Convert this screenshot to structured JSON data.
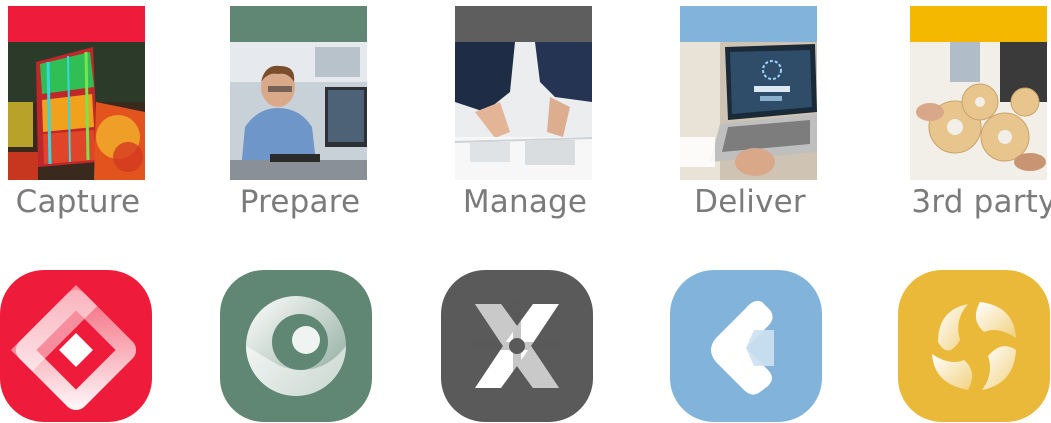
{
  "tiles": [
    {
      "label": "Capture",
      "bar_color": "#ee1c3a",
      "icon_color": "#ee1c3a",
      "icon": "capture-app-icon"
    },
    {
      "label": "Prepare",
      "bar_color": "#5f8774",
      "icon_color": "#5f8774",
      "icon": "prepare-app-icon"
    },
    {
      "label": "Manage",
      "bar_color": "#5e5e5e",
      "icon_color": "#5a5a5a",
      "icon": "manage-app-icon"
    },
    {
      "label": "Deliver",
      "bar_color": "#82b4db",
      "icon_color": "#82b4db",
      "icon": "deliver-app-icon"
    },
    {
      "label": "3rd party",
      "bar_color": "#f5b800",
      "icon_color": "#eab93a",
      "icon": "third-party-app-icon"
    }
  ]
}
